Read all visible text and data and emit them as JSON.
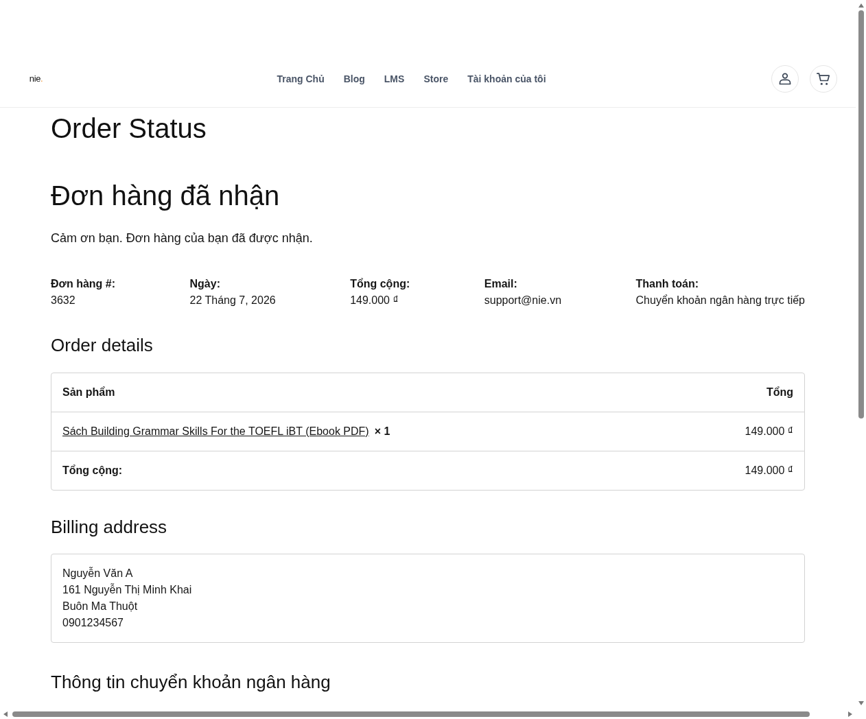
{
  "header": {
    "logo": {
      "text": "nie",
      "accent": "."
    },
    "nav": [
      {
        "label": "Trang Chủ"
      },
      {
        "label": "Blog"
      },
      {
        "label": "LMS"
      },
      {
        "label": "Store"
      },
      {
        "label": "Tài khoản của tôi"
      }
    ]
  },
  "page_title": "Order Status",
  "order_received": {
    "title": "Đơn hàng đã nhận",
    "message": "Cảm ơn bạn. Đơn hàng của bạn đã được nhận."
  },
  "overview": [
    {
      "label": "Đơn hàng #:",
      "value": "3632"
    },
    {
      "label": "Ngày:",
      "value": "22 Tháng 7, 2026"
    },
    {
      "label": "Tổng cộng:",
      "value": "149.000 ₫"
    },
    {
      "label": "Email:",
      "value": "support@nie.vn"
    },
    {
      "label": "Thanh toán:",
      "value": "Chuyển khoản ngân hàng trực tiếp"
    }
  ],
  "order_details": {
    "title": "Order details",
    "columns": [
      "Sản phẩm",
      "Tổng"
    ],
    "items": [
      {
        "product": "Sách Building Grammar Skills For the TOEFL iBT (Ebook PDF)",
        "quantity": "× 1",
        "total": "149.000 ₫"
      }
    ],
    "footer": [
      {
        "label": "Tổng cộng:",
        "value": "149.000 ₫"
      }
    ]
  },
  "billing_address": {
    "title": "Billing address",
    "lines": [
      "Nguyễn Văn A",
      "161 Nguyễn Thị Minh Khai",
      "Buôn Ma Thuột",
      "0901234567"
    ]
  },
  "bank_details": {
    "title": "Thông tin chuyển khoản ngân hàng"
  }
}
